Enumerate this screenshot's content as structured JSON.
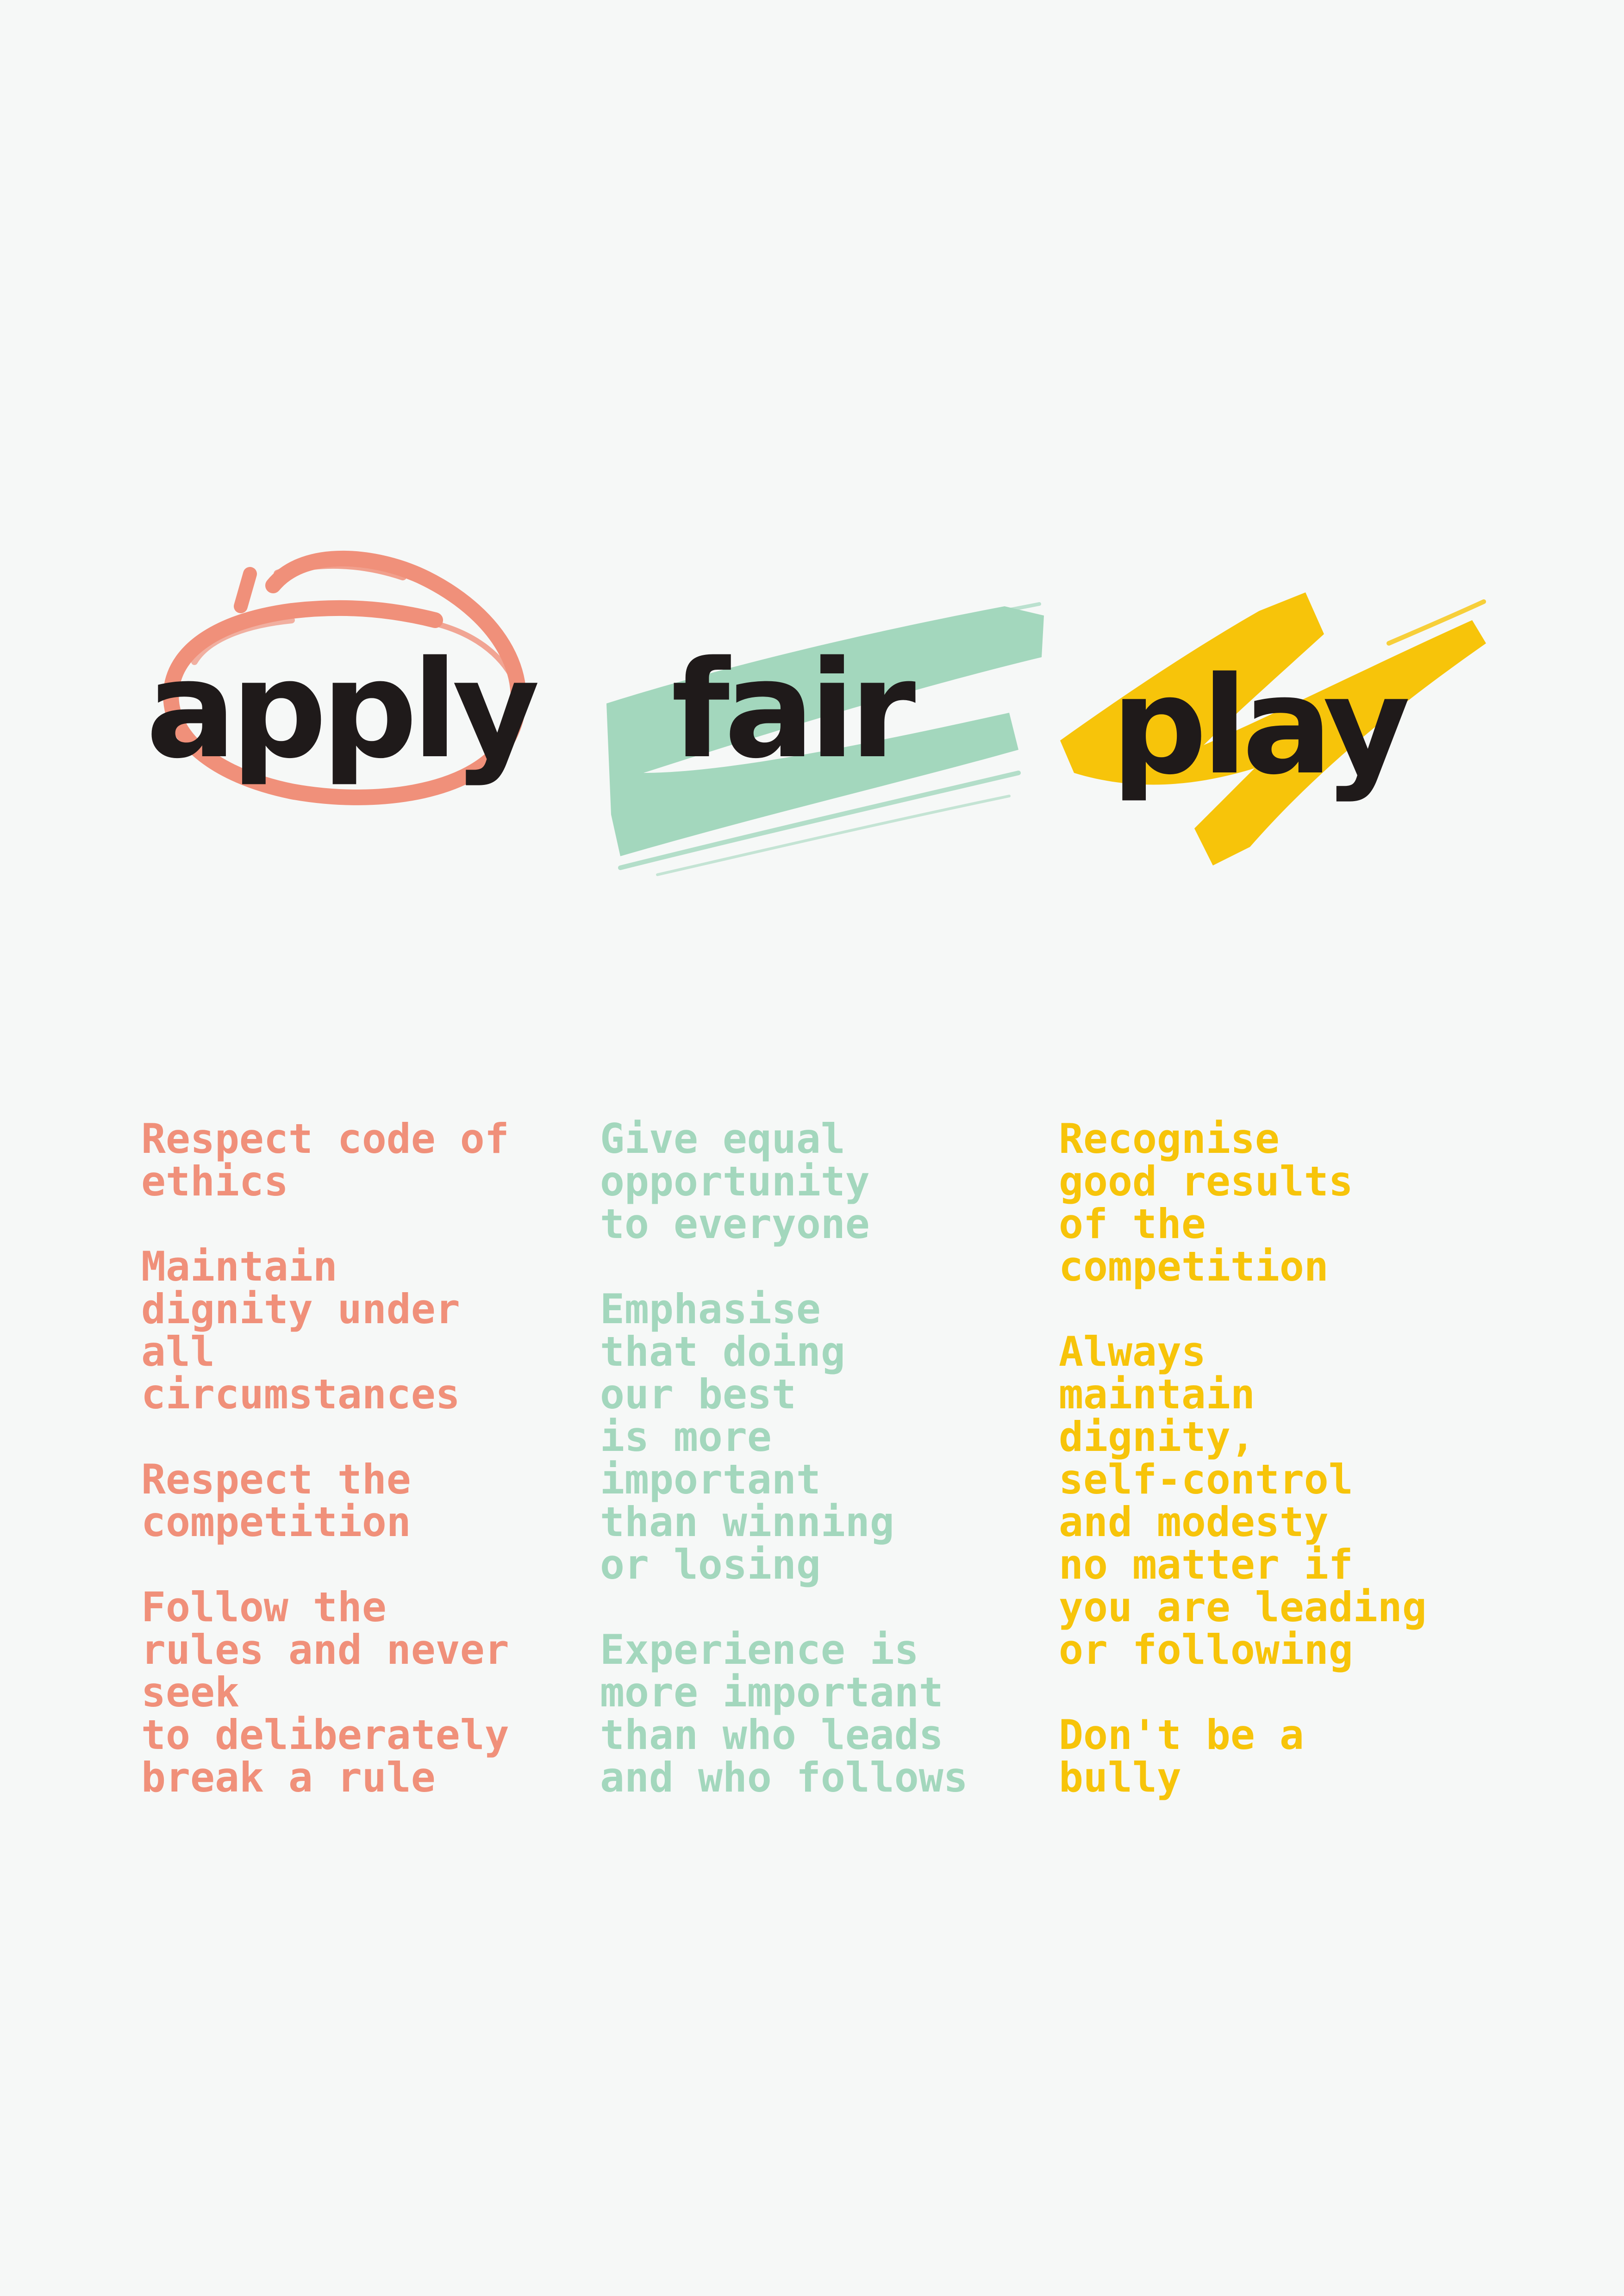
{
  "colors": {
    "background": "#f6f8f7",
    "title_text": "#1f1a1a",
    "apply": "#f0907a",
    "fair": "#a3d7bd",
    "play": "#f7c40a"
  },
  "title": {
    "words": [
      {
        "text": "apply",
        "decoration": "brush-circle",
        "color": "#f0907a"
      },
      {
        "text": "fair",
        "decoration": "brush-swash",
        "color": "#a3d7bd"
      },
      {
        "text": "play",
        "decoration": "brush-zigzag",
        "color": "#f7c40a"
      }
    ]
  },
  "columns": [
    {
      "color": "#f0907a",
      "items": [
        "Respect code of\nethics",
        "Maintain\ndignity under\nall\ncircumstances",
        "Respect the\ncompetition",
        "Follow the\nrules and never\nseek\nto deliberately\nbreak a rule"
      ]
    },
    {
      "color": "#a3d7bd",
      "items": [
        "Give equal\nopportunity\nto everyone",
        "Emphasise\nthat doing\nour best\nis more\nimportant\nthan winning\nor losing",
        "Experience is\nmore important\nthan who leads\nand who follows"
      ]
    },
    {
      "color": "#f7c40a",
      "items": [
        "Recognise\ngood results\nof the\ncompetition",
        "Always\nmaintain\ndignity,\nself-control\nand modesty\nno matter if\nyou are leading\nor following",
        "Don't be a\nbully"
      ]
    }
  ]
}
